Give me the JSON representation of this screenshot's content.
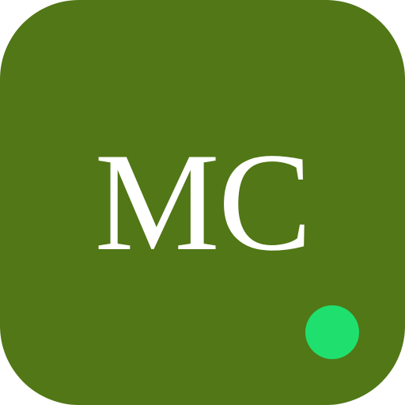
{
  "avatar": {
    "initials": "MC",
    "background_color": "#517716",
    "text_color": "#ffffff"
  },
  "status": {
    "indicator_color": "#1fe06e",
    "state": "online"
  }
}
